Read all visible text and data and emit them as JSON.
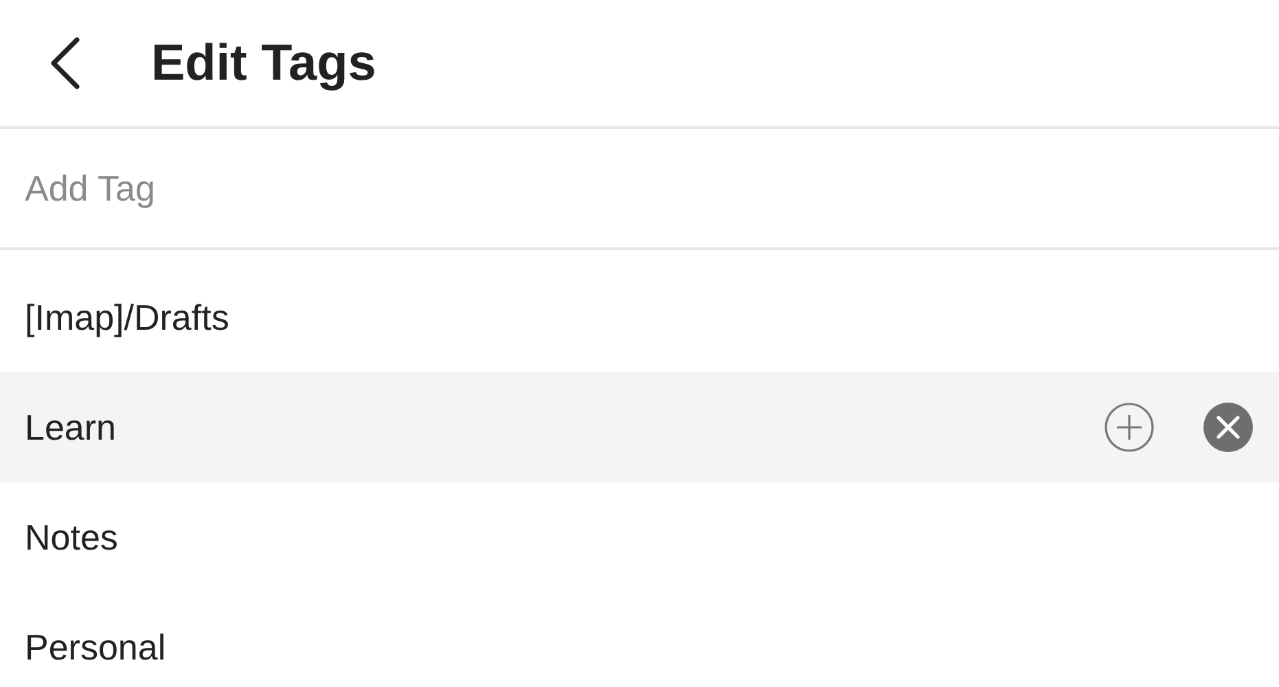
{
  "header": {
    "title": "Edit Tags"
  },
  "add_tag": {
    "placeholder": "Add Tag"
  },
  "tags": [
    {
      "label": "[Imap]/Drafts",
      "selected": false
    },
    {
      "label": "Learn",
      "selected": true
    },
    {
      "label": "Notes",
      "selected": false
    },
    {
      "label": "Personal",
      "selected": false
    }
  ]
}
